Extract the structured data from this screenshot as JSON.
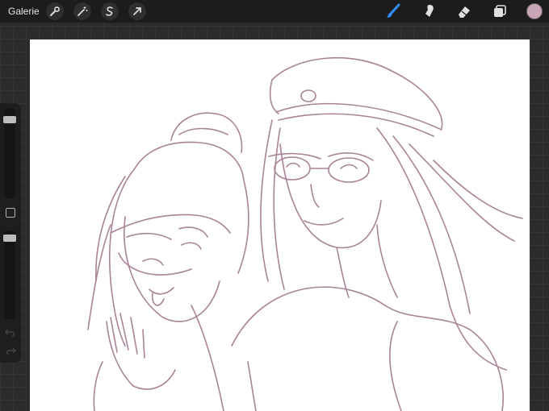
{
  "topbar": {
    "gallery_label": "Galerie",
    "left_tools": [
      "wrench-icon",
      "magic-wand-icon",
      "selection-icon",
      "transform-icon"
    ],
    "right_tools": [
      "brush-icon",
      "smudge-icon",
      "eraser-icon",
      "layers-icon"
    ],
    "active_tool": "brush-icon",
    "accent_color": "#2f8fff",
    "current_color": "#c9a6b6"
  },
  "sidebar": {
    "brush_size_fraction": 0.1,
    "opacity_fraction": 0.05
  },
  "canvas": {
    "background": "#ffffff",
    "stroke_color": "#a98397"
  }
}
